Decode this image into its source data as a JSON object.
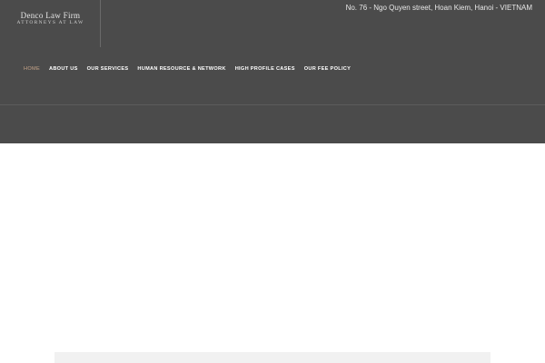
{
  "logo": {
    "name": "Denco Law Firm",
    "tagline": "ATTORNEYS AT LAW"
  },
  "header": {
    "address": "No. 76 - Ngo Quyen street, Hoan Kiem, Hanoi - VIETNAM"
  },
  "nav": {
    "items": [
      {
        "label": "HOME",
        "active": true
      },
      {
        "label": "ABOUT US"
      },
      {
        "label": "OUR SERVICES"
      },
      {
        "label": "HUMAN RESOURCE & NETWORK"
      },
      {
        "label": "HIGH PROFILE CASES"
      },
      {
        "label": "OUR FEE POLICY"
      }
    ]
  },
  "colors": {
    "header_bg": "#4b4b4b",
    "nav_active": "#c9a68a",
    "nav_text": "#ffffff",
    "page_bg": "#ffffff"
  }
}
